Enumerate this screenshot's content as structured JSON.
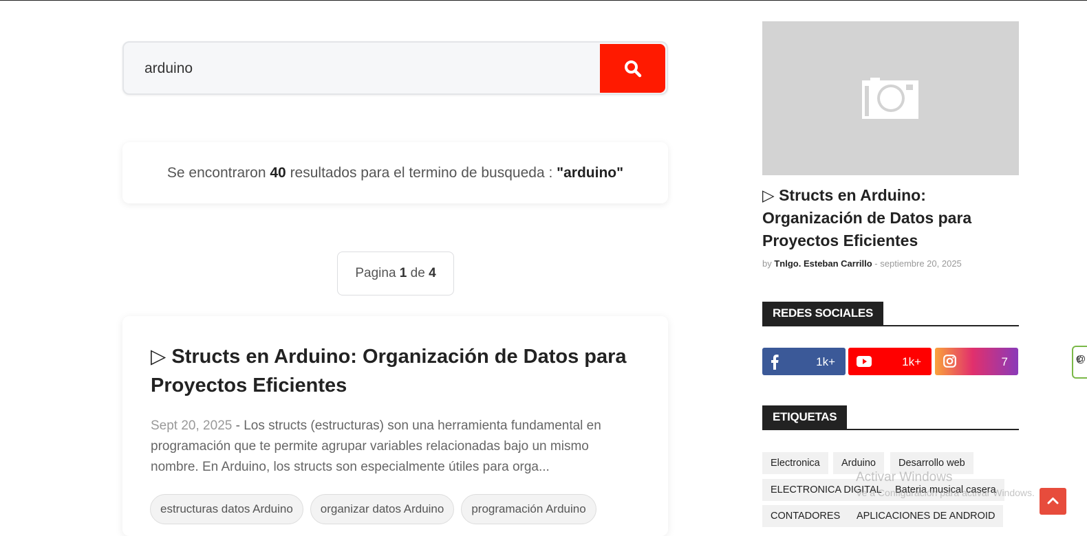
{
  "search": {
    "value": "arduino"
  },
  "results": {
    "prefix": "Se encontraron",
    "count": "40",
    "middle": "resultados para el termino de busqueda :",
    "term": "\"arduino\""
  },
  "pagination": {
    "prefix": "Pagina",
    "current": "1",
    "middle": "de",
    "total": "4"
  },
  "post": {
    "title": "▷ Structs en Arduino: Organización de Datos para Proyectos Eficientes",
    "date": "Sept 20, 2025",
    "separator": " - ",
    "excerpt": "Los structs (estructuras) son una herramienta fundamental en programación que te permite agrupar variables relacionadas bajo un mismo nombre. En Arduino, los structs son especialmente útiles para orga...",
    "tags": [
      "estructuras datos Arduino",
      "organizar datos Arduino",
      "programación Arduino"
    ]
  },
  "sidebar": {
    "featured": {
      "title": "▷ Structs en Arduino: Organización de Datos para Proyectos Eficientes",
      "by": "by",
      "author": "Tnlgo. Esteban Carrillo",
      "dash": "-",
      "date": "septiembre 20, 2025"
    },
    "social_heading": "REDES SOCIALES",
    "social": {
      "facebook_count": "1k+",
      "youtube_count": "1k+",
      "instagram_count": "7"
    },
    "labels_heading": "ETIQUETAS",
    "labels": [
      "Electronica",
      "Arduino",
      "Desarrollo web",
      "ELECTRONICA DIGITAL",
      "Bateria musical casera",
      "CONTADORES",
      "APLICACIONES DE ANDROID"
    ]
  },
  "watermark": {
    "line1": "Activar Windows",
    "line2": "Ve a Configuración para activar Windows."
  },
  "edge_widget": {
    "line1": "€",
    "line2": "@"
  }
}
